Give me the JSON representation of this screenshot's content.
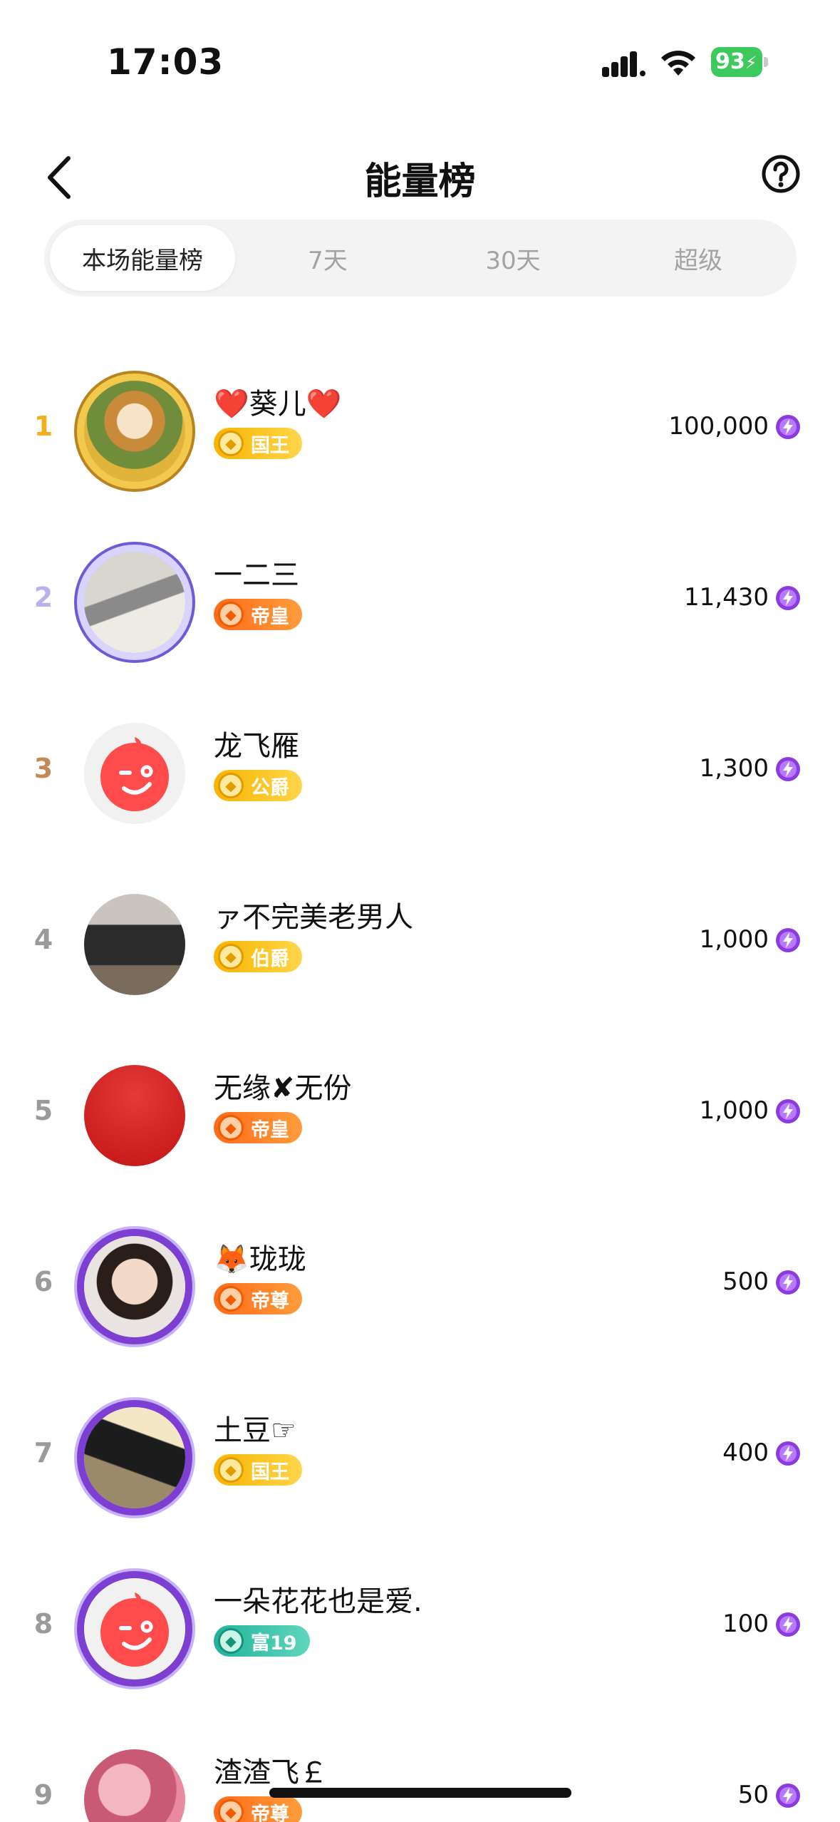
{
  "status_bar": {
    "time": "17:03",
    "battery": "93"
  },
  "header": {
    "title": "能量榜"
  },
  "tabs": [
    {
      "label": "本场能量榜",
      "active": true
    },
    {
      "label": "7天",
      "active": false
    },
    {
      "label": "30天",
      "active": false
    },
    {
      "label": "超级",
      "active": false
    }
  ],
  "colors": {
    "rank1": "#f2b01e",
    "rank2": "#b7b2ee",
    "rank3": "#c48a55",
    "rank_other": "#9a9a9a",
    "energy": "#8b3be0"
  },
  "ranking": [
    {
      "rank": "1",
      "name": "❤️葵儿❤️",
      "badge": "国王",
      "badge_style": "gold",
      "score": "100,000",
      "avatar": "photo-sunflower",
      "frame": "gold"
    },
    {
      "rank": "2",
      "name": "一二三",
      "badge": "帝皇",
      "badge_style": "orange",
      "score": "11,430",
      "avatar": "photo-people",
      "frame": "silver-purple"
    },
    {
      "rank": "3",
      "name": "龙飞雁",
      "badge": "公爵",
      "badge_style": "gold",
      "score": "1,300",
      "avatar": "default-wink",
      "frame": "none"
    },
    {
      "rank": "4",
      "name": "ァ不完美老男人",
      "badge": "伯爵",
      "badge_style": "gold",
      "score": "1,000",
      "avatar": "photo-man",
      "frame": "none"
    },
    {
      "rank": "5",
      "name": "无缘✘无份",
      "badge": "帝皇",
      "badge_style": "orange",
      "score": "1,000",
      "avatar": "red-circle",
      "frame": "none"
    },
    {
      "rank": "6",
      "name": "🦊珑珑",
      "badge": "帝尊",
      "badge_style": "orange",
      "score": "500",
      "avatar": "photo-woman",
      "frame": "purple"
    },
    {
      "rank": "7",
      "name": "土豆☞",
      "badge": "国王",
      "badge_style": "gold",
      "score": "400",
      "avatar": "photo-climbers",
      "frame": "purple"
    },
    {
      "rank": "8",
      "name": "一朵花花也是爱.",
      "badge": "富19",
      "badge_style": "teal",
      "score": "100",
      "avatar": "default-wink",
      "frame": "purple"
    },
    {
      "rank": "9",
      "name": "渣渣飞￡",
      "badge": "帝尊",
      "badge_style": "orange",
      "score": "50",
      "avatar": "photo-pink",
      "frame": "none"
    }
  ]
}
